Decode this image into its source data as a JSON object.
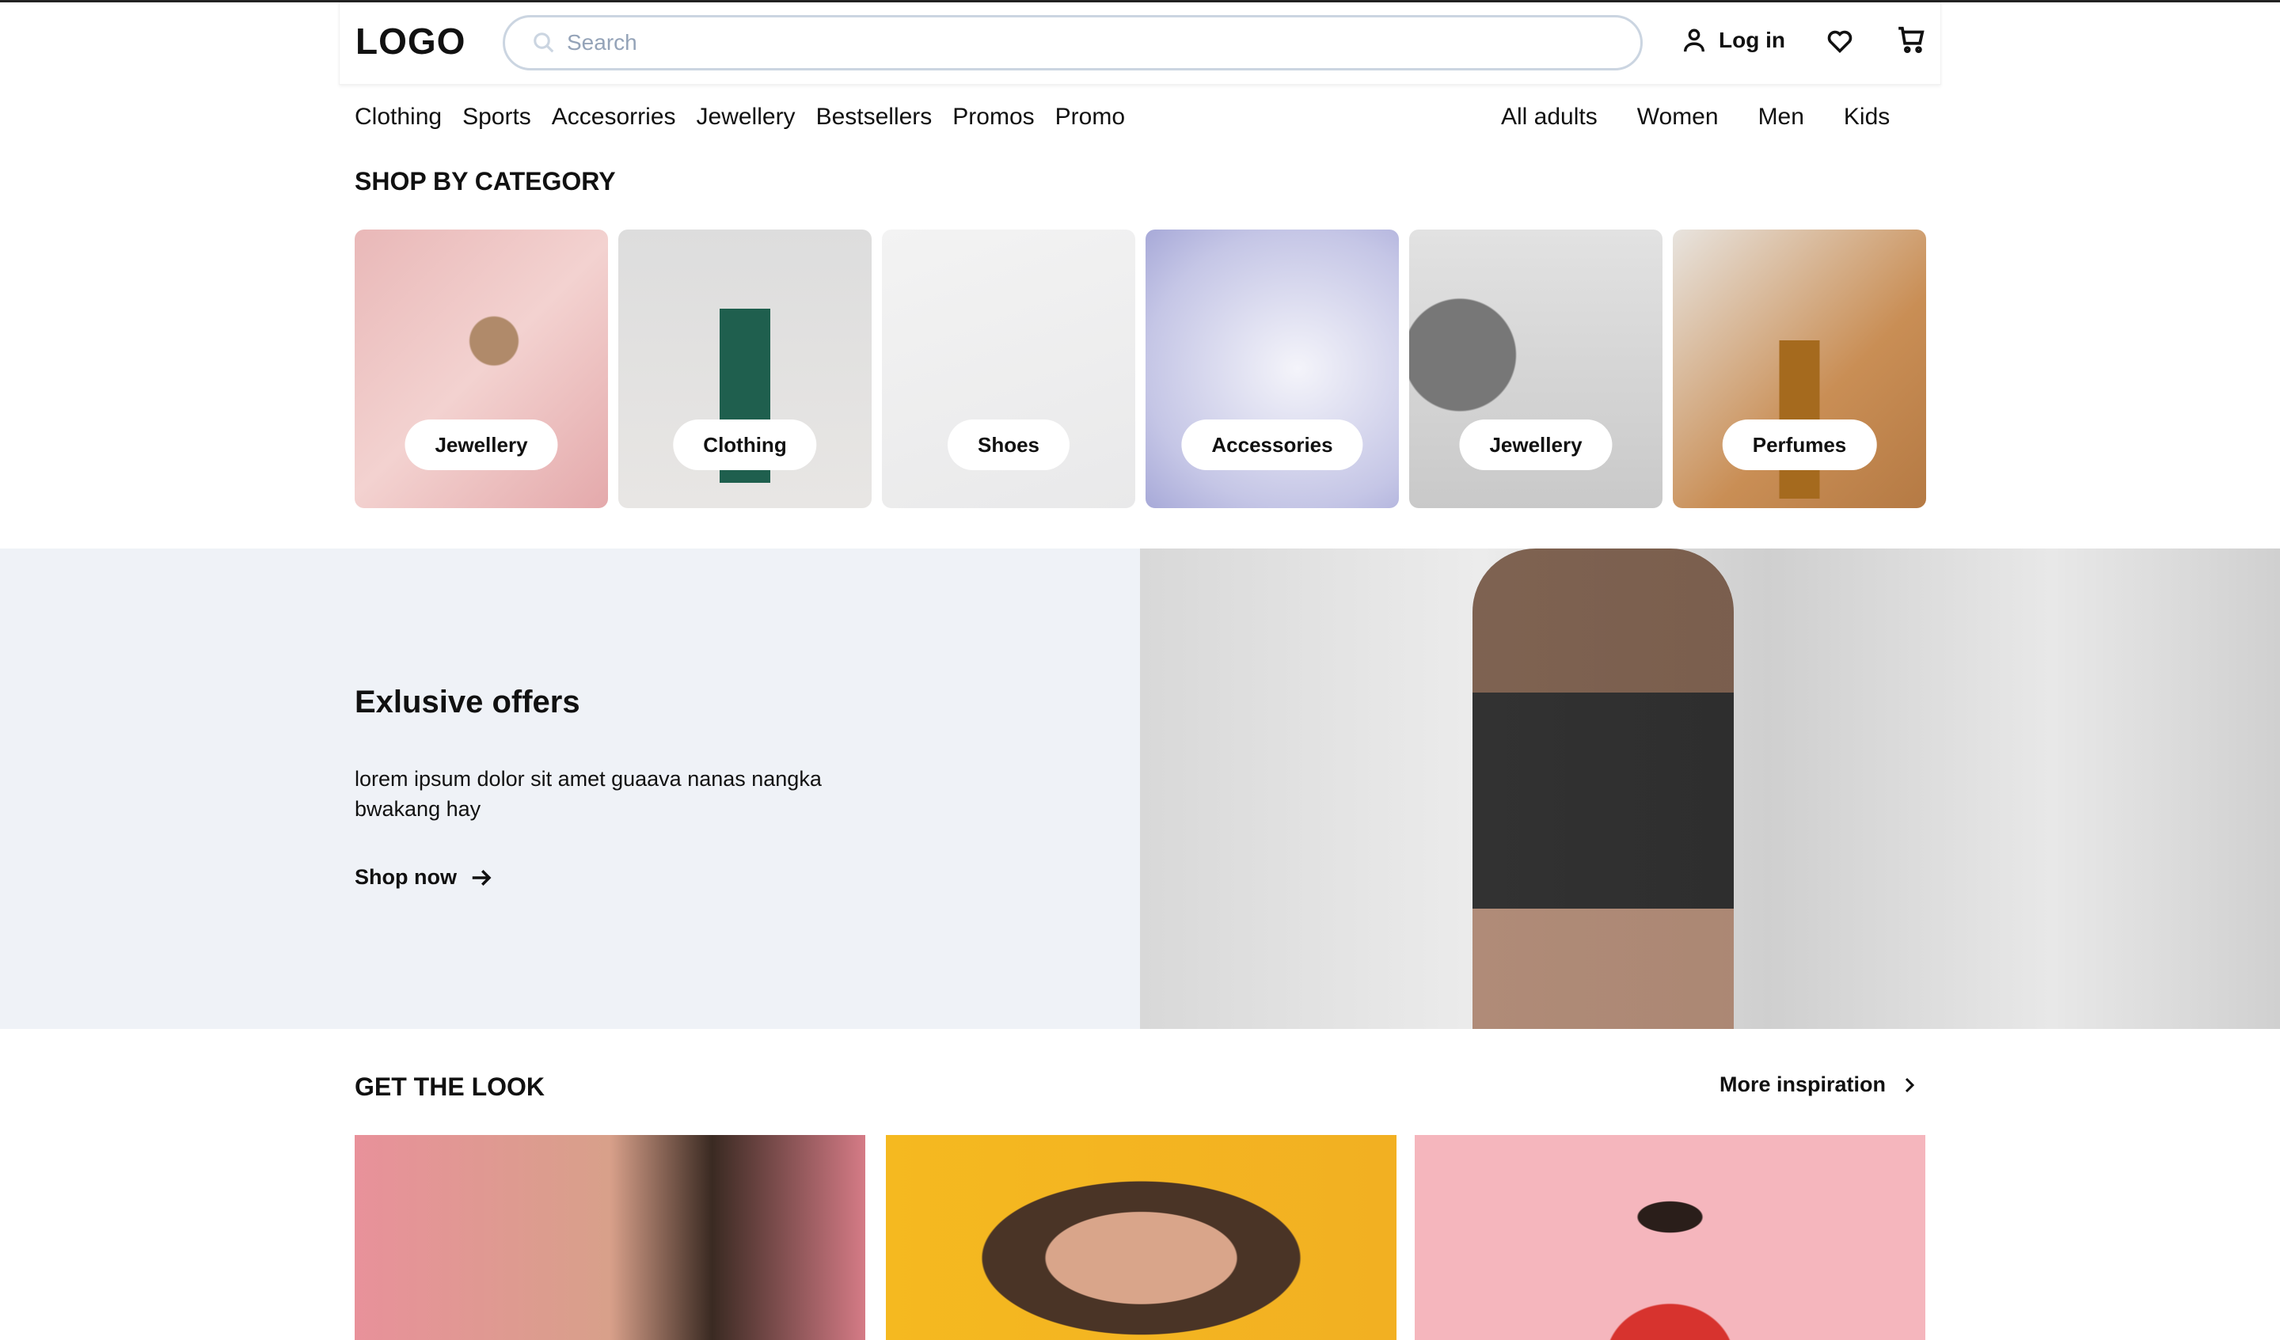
{
  "header": {
    "logo": "LOGO",
    "search_placeholder": "Search",
    "login": "Log in"
  },
  "nav_left": [
    "Clothing",
    "Sports",
    "Accesorries",
    "Jewellery",
    "Bestsellers",
    "Promos",
    "Promo"
  ],
  "nav_right": [
    "All adults",
    "Women",
    "Men",
    "Kids"
  ],
  "categories": {
    "title": "SHOP BY CATEGORY",
    "items": [
      "Jewellery",
      "Clothing",
      "Shoes",
      "Accessories",
      "Jewellery",
      "Perfumes"
    ]
  },
  "banner": {
    "title": "Exlusive offers",
    "text": "lorem ipsum dolor sit amet guaava nanas nangka bwakang hay",
    "cta": "Shop now"
  },
  "look": {
    "title": "GET THE LOOK",
    "more": "More inspiration"
  }
}
